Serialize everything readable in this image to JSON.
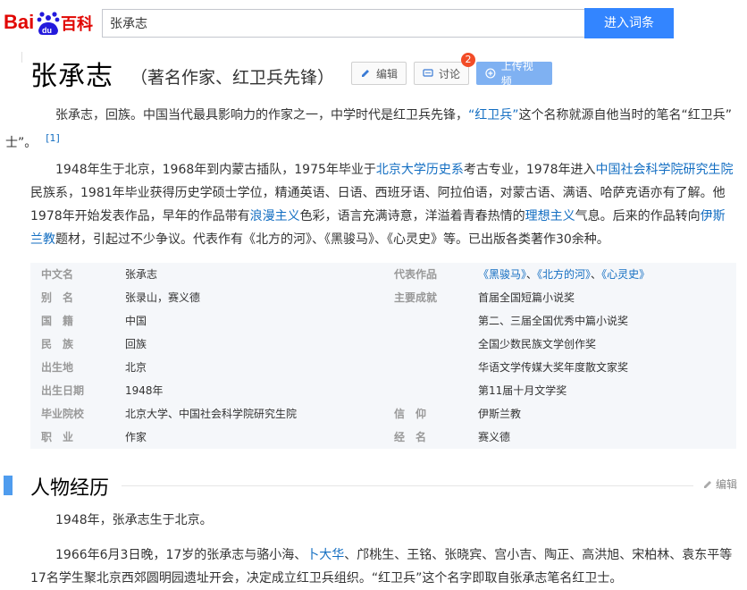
{
  "header": {
    "logo_text_left": "Bai",
    "logo_text_du": "du",
    "logo_text_right": "百科",
    "search_value": "张承志",
    "search_button": "进入词条"
  },
  "title": {
    "name": "张承志",
    "subtitle": "（著名作家、红卫兵先锋）"
  },
  "toolbar": {
    "edit": "编辑",
    "discuss": "讨论",
    "discuss_badge": "2",
    "upload": "上传视频"
  },
  "intro": {
    "p1_a": "张承志，回族。中国当代最具影响力的作家之一，中学时代是红卫兵先锋，",
    "p1_link": "“红卫兵”",
    "p1_b": "这个名称就源自他当时的笔名“红卫兵”",
    "p1_c": "士”。",
    "p1_ref": "[1]",
    "p2_a": "1948年生于北京，1968年到内蒙古插队，1975年毕业于",
    "p2_link1": "北京大学历史系",
    "p2_b": "考古专业，1978年进入",
    "p2_link2": "中国社会科学院研究生院",
    "p2_c": "民族系，1981年毕业获得历史学硕士学位，精通英语、日语、西班牙语、阿拉伯语，对蒙古语、满语、哈萨克语亦有了解。他1978年开始发表作品，早年的作品带有",
    "p2_link3": "浪漫主义",
    "p2_d": "色彩，语言充满诗意，洋溢着青春热情的",
    "p2_link4": "理想主义",
    "p2_e": "气息。后来的作品转向",
    "p2_link5": "伊斯兰教",
    "p2_f": "题材，引起过不少争议。代表作有《北方的河》、《黑骏马》、《心灵史》等。已出版各类著作30余种。"
  },
  "basic_info": {
    "left": [
      {
        "key": "中文名",
        "value": "张承志",
        "link": false
      },
      {
        "key": "别　名",
        "value": "张录山，赛义德",
        "link": false
      },
      {
        "key": "国　籍",
        "value": "中国",
        "link": true
      },
      {
        "key": "民　族",
        "value": "回族",
        "link": false
      },
      {
        "key": "出生地",
        "value": "北京",
        "link": false
      },
      {
        "key": "出生日期",
        "value": "1948年",
        "link": false
      },
      {
        "key": "毕业院校",
        "value": "北京大学、中国社会科学院研究生院",
        "link": false
      },
      {
        "key": "职　业",
        "value": "作家",
        "link": true
      }
    ],
    "right_works_key": "代表作品",
    "right_works": [
      "《黑骏马》",
      "《北方的河》",
      "《心灵史》"
    ],
    "right_works_sep": "、",
    "right": [
      {
        "key": "主要成就",
        "value": "首届全国短篇小说奖"
      },
      {
        "key": "",
        "value": "第二、三届全国优秀中篇小说奖"
      },
      {
        "key": "",
        "value": "全国少数民族文学创作奖"
      },
      {
        "key": "",
        "value_link": "华语文学传媒大奖",
        "value": "年度散文家奖"
      },
      {
        "key": "",
        "value": "第11届十月文学奖"
      },
      {
        "key": "信　仰",
        "value": "伊斯兰教"
      },
      {
        "key": "经　名",
        "value": "赛义德"
      }
    ]
  },
  "section": {
    "title": "人物经历",
    "edit": "编辑"
  },
  "biography": {
    "p1": "1948年，张承志生于北京。",
    "p2_a": "1966年6月3日晚，17岁的张承志与骆小海、",
    "p2_link": "卜大华",
    "p2_b": "、邝桃生、王铭、张晓宾、宫小吉、陶正、高洪旭、宋柏林、袁东平等17名学生聚北京西郊圆明园遗址开会，决定成立红卫兵组织。“红卫兵”这个名字即取自张承志笔名红卫士。"
  },
  "colors": {
    "accent": "#3385ff",
    "link": "#136ec2",
    "badge": "#f24c27",
    "section_bar": "#4f9cee"
  }
}
